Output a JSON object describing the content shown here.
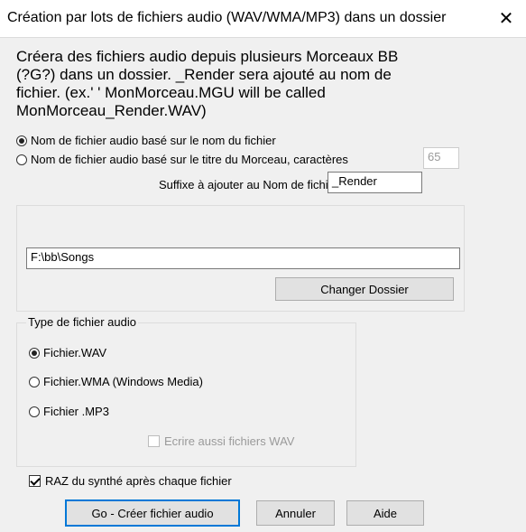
{
  "window": {
    "title": "Création par lots de fichiers audio (WAV/WMA/MP3) dans un dossier",
    "close_glyph": "✕"
  },
  "description": {
    "lines": [
      "Créera des fichiers audio depuis plusieurs Morceaux BB",
      "(?G?) dans un dossier.  _Render sera ajouté au nom de",
      "fichier. (ex.'       ' MonMorceau.MGU will be called",
      "MonMorceau_Render.WAV)"
    ]
  },
  "naming": {
    "option_filename": "Nom de fichier audio basé sur le nom du fichier",
    "option_title": "Nom de fichier audio basé sur le titre du  Morceau,  caractères",
    "characters_value": "65",
    "selected": "filename"
  },
  "suffix": {
    "label": "Suffixe à ajouter au Nom de fichier",
    "value": "_Render"
  },
  "folder": {
    "path": "F:\\bb\\Songs",
    "change_button": "Changer Dossier"
  },
  "audio_type": {
    "legend": "Type de fichier audio",
    "options": [
      "Fichier.WAV",
      "Fichier.WMA  (Windows Media)",
      "Fichier .MP3"
    ],
    "selected_index": 0,
    "also_wav_label": "Ecrire aussi fichiers WAV",
    "also_wav_checked": false
  },
  "reset_synth": {
    "label": "RAZ du synthé après chaque fichier",
    "checked": true
  },
  "buttons": {
    "go": "Go - Créer fichier audio",
    "cancel": "Annuler",
    "help": "Aide"
  }
}
